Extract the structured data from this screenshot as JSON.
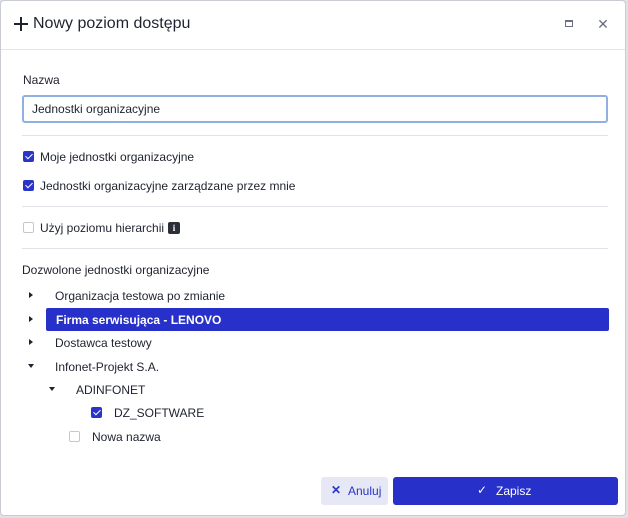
{
  "dialog": {
    "title": "Nowy poziom dostępu"
  },
  "form": {
    "name_label": "Nazwa",
    "name_value": "Jednostki organizacyjne",
    "checkboxes": [
      {
        "label": "Moje jednostki organizacyjne",
        "checked": true
      },
      {
        "label": "Jednostki organizacyjne zarządzane przez mnie",
        "checked": true
      },
      {
        "label": "Użyj poziomu hierarchii",
        "checked": false
      }
    ],
    "allowed_units_label": "Dozwolone jednostki organizacyjne"
  },
  "tree": {
    "items": [
      {
        "label": "Organizacja testowa po zmianie",
        "expanded": false
      },
      {
        "label": "Firma serwisująca - LENOVO",
        "expanded": false,
        "selected": true
      },
      {
        "label": "Dostawca testowy",
        "expanded": false
      },
      {
        "label": "Infonet-Projekt S.A.",
        "expanded": true
      },
      {
        "label": "ADINFONET",
        "expanded": true
      },
      {
        "label": "DZ_SOFTWARE",
        "checked": true
      },
      {
        "label": "Nowa nazwa",
        "checked": false
      }
    ]
  },
  "footer": {
    "cancel_label": "Anuluj",
    "save_label": "Zapisz"
  },
  "colors": {
    "accent": "#2730c8",
    "cancel_bg": "#e6e8f6",
    "input_border": "#8fb0e0"
  },
  "icons": {
    "header": "plus-icon",
    "maximize": "maximize-icon",
    "close": "close-icon",
    "info": "info-icon",
    "cancel": "close-icon",
    "save": "check-icon"
  }
}
